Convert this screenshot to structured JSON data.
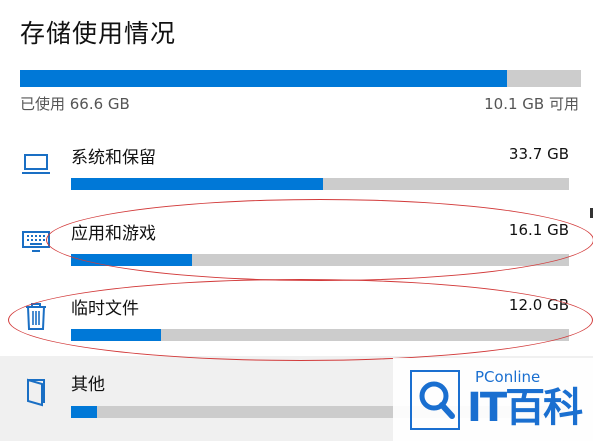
{
  "header": {
    "title": "存储使用情况"
  },
  "overall": {
    "used_label": "已使用 66.6 GB",
    "free_label": "10.1 GB 可用",
    "used_fraction": 0.868
  },
  "categories": [
    {
      "name": "系统和保留",
      "size": "33.7 GB",
      "fraction": 0.506,
      "icon": "laptop-icon"
    },
    {
      "name": "应用和游戏",
      "size": "16.1 GB",
      "fraction": 0.242,
      "icon": "keyboard-icon"
    },
    {
      "name": "临时文件",
      "size": "12.0 GB",
      "fraction": 0.181,
      "icon": "trash-icon"
    },
    {
      "name": "其他",
      "size": "",
      "fraction": 0.052,
      "icon": "folder-icon"
    }
  ],
  "watermark": {
    "small": "PConline",
    "big": "IT百科"
  },
  "colors": {
    "accent": "#0078d7",
    "track": "#cccccc",
    "annotation": "#d23a3a"
  }
}
